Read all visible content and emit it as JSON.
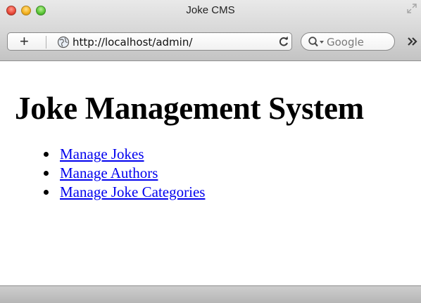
{
  "window": {
    "title": "Joke CMS"
  },
  "toolbar": {
    "add_label": "+",
    "url": "http://localhost/admin/",
    "search_placeholder": "Google"
  },
  "page": {
    "heading": "Joke Management System",
    "links": [
      {
        "label": "Manage Jokes"
      },
      {
        "label": "Manage Authors"
      },
      {
        "label": "Manage Joke Categories"
      }
    ]
  },
  "colors": {
    "link": "#0000ee",
    "close": "#ec4d3e",
    "minimize": "#f5b321",
    "zoom": "#5fc93a"
  },
  "icons": [
    "close-icon",
    "minimize-icon",
    "zoom-icon",
    "fullscreen-icon",
    "globe-icon",
    "reload-icon",
    "search-icon",
    "overflow-icon"
  ]
}
